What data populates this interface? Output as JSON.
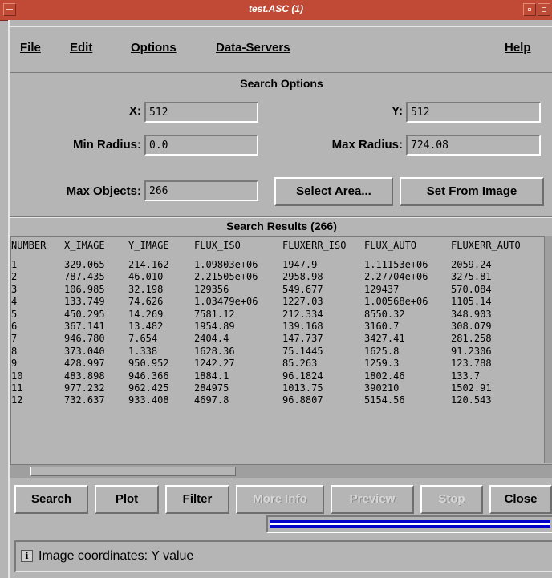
{
  "window": {
    "title": "test.ASC (1)"
  },
  "menu": {
    "file": "File",
    "edit": "Edit",
    "options": "Options",
    "data_servers": "Data-Servers",
    "help": "Help"
  },
  "search_options": {
    "title": "Search Options",
    "x_label": "X:",
    "x_value": "512",
    "y_label": "Y:",
    "y_value": "512",
    "min_radius_label": "Min Radius:",
    "min_radius_value": "0.0",
    "max_radius_label": "Max Radius:",
    "max_radius_value": "724.08",
    "max_objects_label": "Max Objects:",
    "max_objects_value": "266",
    "select_area_button": "Select Area...",
    "set_from_image_button": "Set From Image"
  },
  "results": {
    "title": "Search Results (266)",
    "columns": [
      "NUMBER",
      "X_IMAGE",
      "Y_IMAGE",
      "FLUX_ISO",
      "FLUXERR_ISO",
      "FLUX_AUTO",
      "FLUXERR_AUTO"
    ],
    "rows": [
      [
        "1",
        "329.065",
        "214.162",
        "1.09803e+06",
        "1947.9",
        "1.11153e+06",
        "2059.24"
      ],
      [
        "2",
        "787.435",
        "46.010",
        "2.21505e+06",
        "2958.98",
        "2.27704e+06",
        "3275.81"
      ],
      [
        "3",
        "106.985",
        "32.198",
        "129356",
        "549.677",
        "129437",
        "570.084"
      ],
      [
        "4",
        "133.749",
        "74.626",
        "1.03479e+06",
        "1227.03",
        "1.00568e+06",
        "1105.14"
      ],
      [
        "5",
        "450.295",
        "14.269",
        "7581.12",
        "212.334",
        "8550.32",
        "348.903"
      ],
      [
        "6",
        "367.141",
        "13.482",
        "1954.89",
        "139.168",
        "3160.7",
        "308.079"
      ],
      [
        "7",
        "946.780",
        "7.654",
        "2404.4",
        "147.737",
        "3427.41",
        "281.258"
      ],
      [
        "8",
        "373.040",
        "1.338",
        "1628.36",
        "75.1445",
        "1625.8",
        "91.2306"
      ],
      [
        "9",
        "428.997",
        "950.952",
        "1242.27",
        "85.263",
        "1259.3",
        "123.788"
      ],
      [
        "10",
        "483.898",
        "946.366",
        "1884.1",
        "96.1824",
        "1802.46",
        "133.7"
      ],
      [
        "11",
        "977.232",
        "962.425",
        "284975",
        "1013.75",
        "390210",
        "1502.91"
      ],
      [
        "12",
        "732.637",
        "933.408",
        "4697.8",
        "96.8807",
        "5154.56",
        "120.543"
      ]
    ]
  },
  "buttons": {
    "search": "Search",
    "plot": "Plot",
    "filter": "Filter",
    "more_info": "More Info",
    "preview": "Preview",
    "stop": "Stop",
    "close": "Close"
  },
  "status": {
    "icon": "info-icon",
    "text": "Image coordinates: Y value"
  }
}
